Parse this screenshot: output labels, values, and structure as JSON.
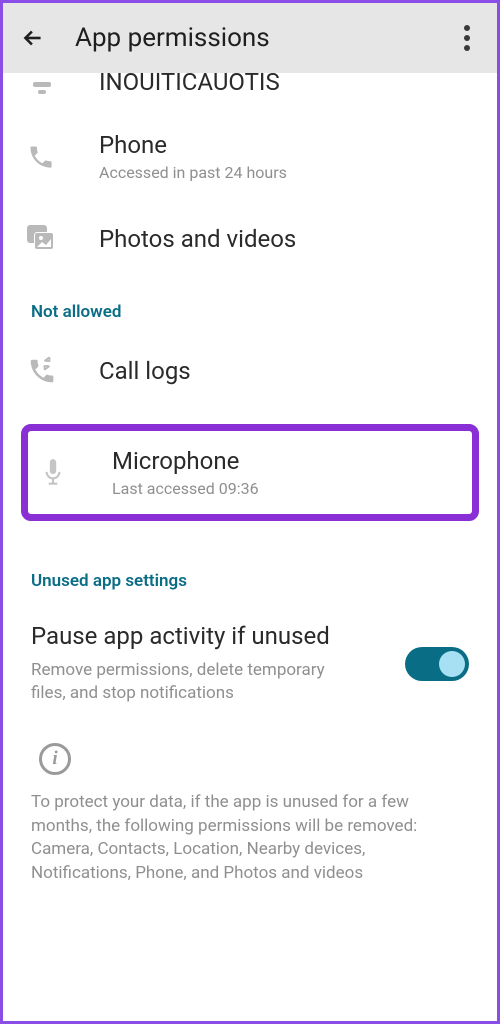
{
  "header": {
    "title": "App permissions"
  },
  "allowed": {
    "notifications": {
      "label": "INOUITICAUOTIS"
    },
    "phone": {
      "label": "Phone",
      "sub": "Accessed in past 24 hours"
    },
    "photos": {
      "label": "Photos and videos"
    }
  },
  "sections": {
    "not_allowed": "Not allowed",
    "unused": "Unused app settings"
  },
  "not_allowed": {
    "call_logs": {
      "label": "Call logs"
    },
    "microphone": {
      "label": "Microphone",
      "sub": "Last accessed 09:36"
    }
  },
  "pause": {
    "title": "Pause app activity if unused",
    "desc": "Remove permissions, delete temporary files, and stop notifications"
  },
  "footer": "To protect your data, if the app is unused for a few months, the following permissions will be removed: Camera, Contacts, Location, Nearby devices, Notifications, Phone, and Photos and videos"
}
